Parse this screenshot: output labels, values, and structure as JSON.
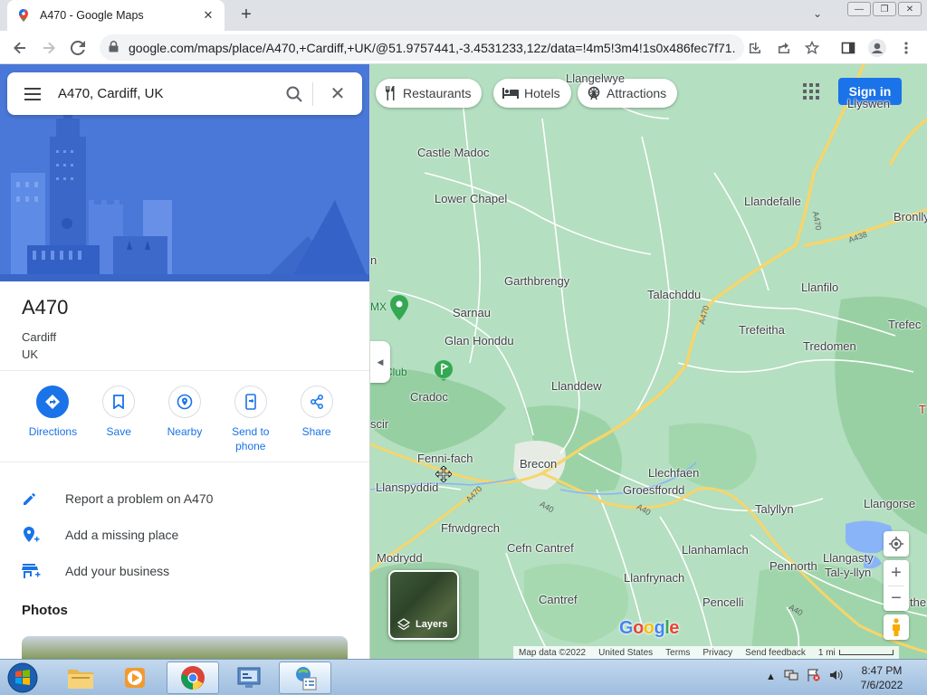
{
  "browser": {
    "tab_title": "A470 - Google Maps",
    "tab_close": "✕",
    "new_tab": "+",
    "url": "google.com/maps/place/A470,+Cardiff,+UK/@51.9757441,-3.4531233,12z/data=!4m5!3m4!1s0x486fec7f71..."
  },
  "search": {
    "query": "A470, Cardiff, UK"
  },
  "place": {
    "name": "A470",
    "line1": "Cardiff",
    "line2": "UK"
  },
  "actions": [
    {
      "label": "Directions"
    },
    {
      "label": "Save"
    },
    {
      "label": "Nearby"
    },
    {
      "label": "Send to phone"
    },
    {
      "label": "Share"
    }
  ],
  "links": [
    {
      "label": "Report a problem on A470"
    },
    {
      "label": "Add a missing place"
    },
    {
      "label": "Add your business"
    }
  ],
  "photos_heading": "Photos",
  "map": {
    "chips": [
      "Restaurants",
      "Hotels",
      "Attractions"
    ],
    "signin": "Sign in",
    "layers": "Layers",
    "google": [
      "G",
      "o",
      "o",
      "g",
      "l",
      "e"
    ],
    "google_colors": [
      "#4285F4",
      "#EA4335",
      "#FBBC05",
      "#4285F4",
      "#34A853",
      "#EA4335"
    ],
    "attribution": {
      "map_data": "Map data ©2022",
      "country": "United States",
      "terms": "Terms",
      "privacy": "Privacy",
      "feedback": "Send feedback",
      "scale": "1 mi"
    },
    "towns": {
      "llangelwye": "Llangelwye",
      "llyswen": "Llyswen",
      "castle_madoc": "Castle Madoc",
      "lower_chapel": "Lower Chapel",
      "llandefalle": "Llandefalle",
      "bronllys": "Bronlly",
      "garthbrengy": "Garthbrengy",
      "talachddu": "Talachddu",
      "llanfilo": "Llanfilo",
      "sarnau": "Sarnau",
      "trefeitha": "Trefeitha",
      "trefecca": "Trefec",
      "glan_honddu": "Glan Honddu",
      "tredomen": "Tredomen",
      "cradoc": "Cradoc",
      "llanddew": "Llanddew",
      "scir": "scir",
      "fenni_fach": "Fenni-fach",
      "brecon": "Brecon",
      "llechfaen": "Llechfaen",
      "llanspyddid": "Llanspyddid",
      "groesffordd": "Groesffordd",
      "talyllyn": "Talyllyn",
      "llangorse": "Llangorse",
      "ffrwdgrech": "Ffrwdgrech",
      "cefn_cantref": "Cefn Cantref",
      "llanhamlach": "Llanhamlach",
      "modrydd": "Modrydd",
      "llangasty": "Llangasty",
      "tal_y_llyn": "Tal-y-llyn",
      "llanfrynach": "Llanfrynach",
      "pennorth": "Pennorth",
      "cantref": "Cantref",
      "pencelli": "Pencelli",
      "the": "the",
      "n_edge": "n",
      "t_edge": "T"
    },
    "pois": {
      "mx": "MX",
      "golf": "olf Club"
    },
    "roads": {
      "a470_n": "A470",
      "a438": "A438",
      "a470_mid": "A470",
      "a470_sw": "A470",
      "a40_w": "A40",
      "a40_e": "A40",
      "a40_se": "A40"
    }
  },
  "taskbar": {
    "time": "8:47 PM",
    "date": "7/6/2022"
  }
}
